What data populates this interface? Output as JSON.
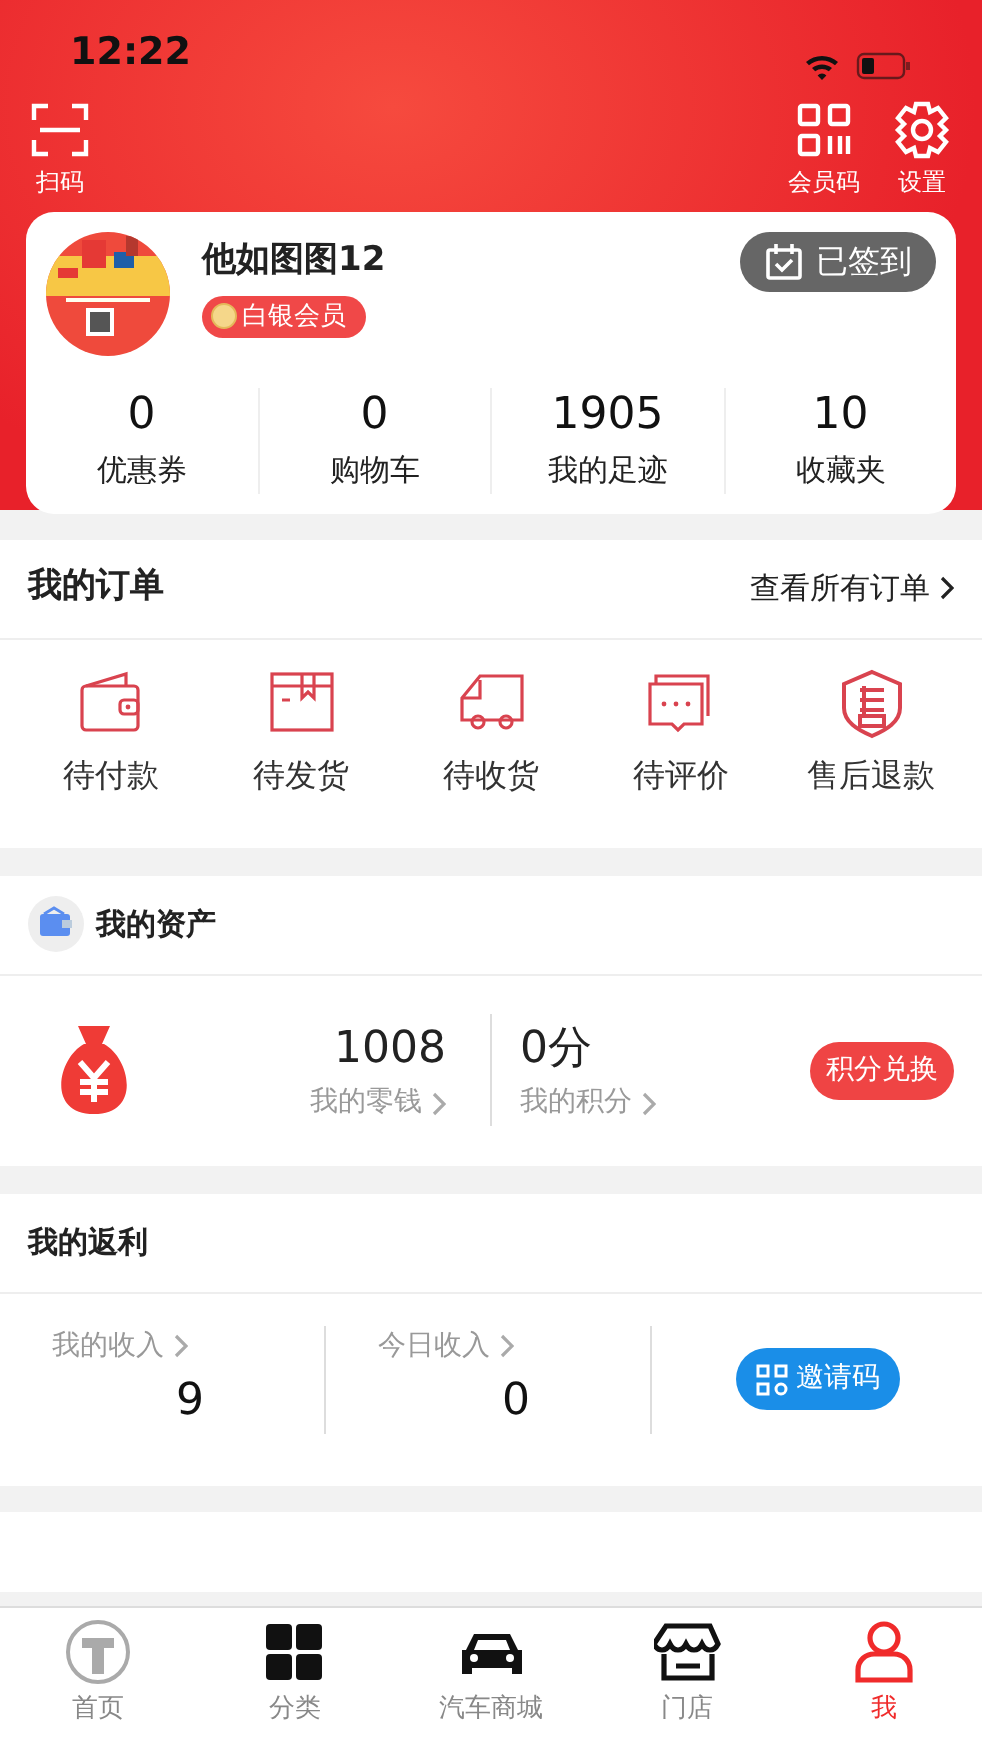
{
  "status_bar": {
    "time": "12:22"
  },
  "header": {
    "left_actions": [
      {
        "label": "扫码",
        "kind": "scan"
      }
    ],
    "right_actions": [
      {
        "label": "会员码",
        "kind": "qr"
      },
      {
        "label": "设置",
        "kind": "gear"
      }
    ]
  },
  "profile": {
    "name": "他如图图12",
    "badge": "白银会员",
    "checkin_button": "已签到",
    "stats": [
      {
        "value": "0",
        "label": "优惠券"
      },
      {
        "value": "0",
        "label": "购物车"
      },
      {
        "value": "1905",
        "label": "我的足迹"
      },
      {
        "value": "10",
        "label": "收藏夹"
      }
    ]
  },
  "orders": {
    "title": "我的订单",
    "view_all": "查看所有订单",
    "items": [
      {
        "label": "待付款",
        "kind": "wallet"
      },
      {
        "label": "待发货",
        "kind": "box"
      },
      {
        "label": "待收货",
        "kind": "truck"
      },
      {
        "label": "待评价",
        "kind": "chat"
      },
      {
        "label": "售后退款",
        "kind": "shield"
      }
    ]
  },
  "assets": {
    "title": "我的资产",
    "balance": {
      "value": "1008",
      "label": "我的零钱"
    },
    "points": {
      "value": "0分",
      "label": "我的积分"
    },
    "exchange_button": "积分兑换"
  },
  "rebate": {
    "title": "我的返利",
    "items": [
      {
        "label": "我的收入",
        "value": "9"
      },
      {
        "label": "今日收入",
        "value": "0"
      }
    ],
    "invite_button": "邀请码"
  },
  "tab_bar": [
    {
      "label": "首页",
      "kind": "home",
      "selected": false
    },
    {
      "label": "分类",
      "kind": "grid",
      "selected": false
    },
    {
      "label": "汽车商城",
      "kind": "car",
      "selected": false
    },
    {
      "label": "门店",
      "kind": "store",
      "selected": false
    },
    {
      "label": "我",
      "kind": "person",
      "selected": true
    }
  ]
}
